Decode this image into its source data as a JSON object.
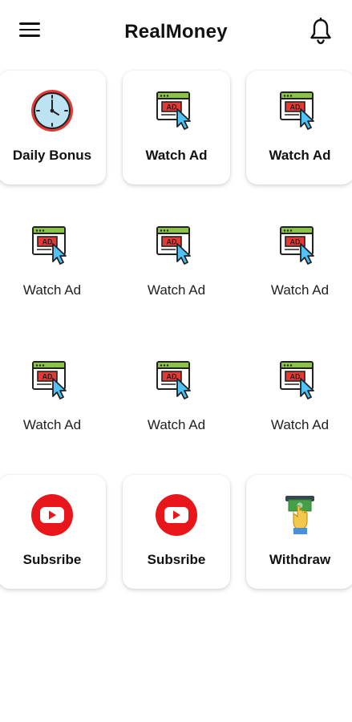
{
  "app": {
    "title": "RealMoney"
  },
  "icons": {
    "menu": "menu-icon",
    "bell": "bell-icon",
    "clock": "clock-icon",
    "ad": "ad-window-icon",
    "youtube": "youtube-icon",
    "cash": "cash-withdraw-icon"
  },
  "colors": {
    "youtube_red": "#E8151B",
    "ad_red": "#E53935",
    "ad_green": "#8BC34A",
    "cursor_blue": "#4FC3F7",
    "clock_face": "#BDE3F2"
  },
  "tiles": [
    {
      "label": "Daily Bonus",
      "icon": "clock-icon",
      "style": "card"
    },
    {
      "label": "Watch Ad",
      "icon": "ad-window-icon",
      "style": "card"
    },
    {
      "label": "Watch Ad",
      "icon": "ad-window-icon",
      "style": "card"
    },
    {
      "label": "Watch Ad",
      "icon": "ad-window-icon",
      "style": "plain"
    },
    {
      "label": "Watch Ad",
      "icon": "ad-window-icon",
      "style": "plain"
    },
    {
      "label": "Watch Ad",
      "icon": "ad-window-icon",
      "style": "plain"
    },
    {
      "label": "Watch Ad",
      "icon": "ad-window-icon",
      "style": "plain"
    },
    {
      "label": "Watch Ad",
      "icon": "ad-window-icon",
      "style": "plain"
    },
    {
      "label": "Watch Ad",
      "icon": "ad-window-icon",
      "style": "plain"
    },
    {
      "label": "Subsribe",
      "icon": "youtube-icon",
      "style": "card"
    },
    {
      "label": "Subsribe",
      "icon": "youtube-icon",
      "style": "card"
    },
    {
      "label": "Withdraw",
      "icon": "cash-withdraw-icon",
      "style": "card"
    }
  ]
}
